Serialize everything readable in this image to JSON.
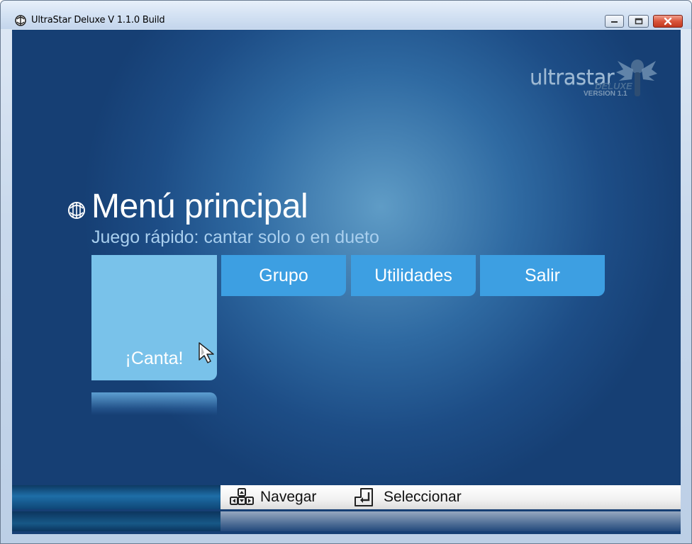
{
  "window": {
    "title": "UltraStar Deluxe V 1.1.0 Build"
  },
  "logo": {
    "text": "ultrastar",
    "deluxe": "DELUXE",
    "version": "VERSION 1.1"
  },
  "header": {
    "title": "Menú principal",
    "subtitle": "Juego rápido: cantar solo o en dueto"
  },
  "menu": {
    "items": [
      {
        "label": "¡Canta!",
        "selected": true
      },
      {
        "label": "Grupo"
      },
      {
        "label": "Utilidades"
      },
      {
        "label": "Salir"
      }
    ]
  },
  "footer": {
    "navigate": "Navegar",
    "select": "Seleccionar"
  },
  "colors": {
    "button": "#3d9fe2",
    "button_selected": "#79c2ea",
    "background": "#1d4d86"
  }
}
